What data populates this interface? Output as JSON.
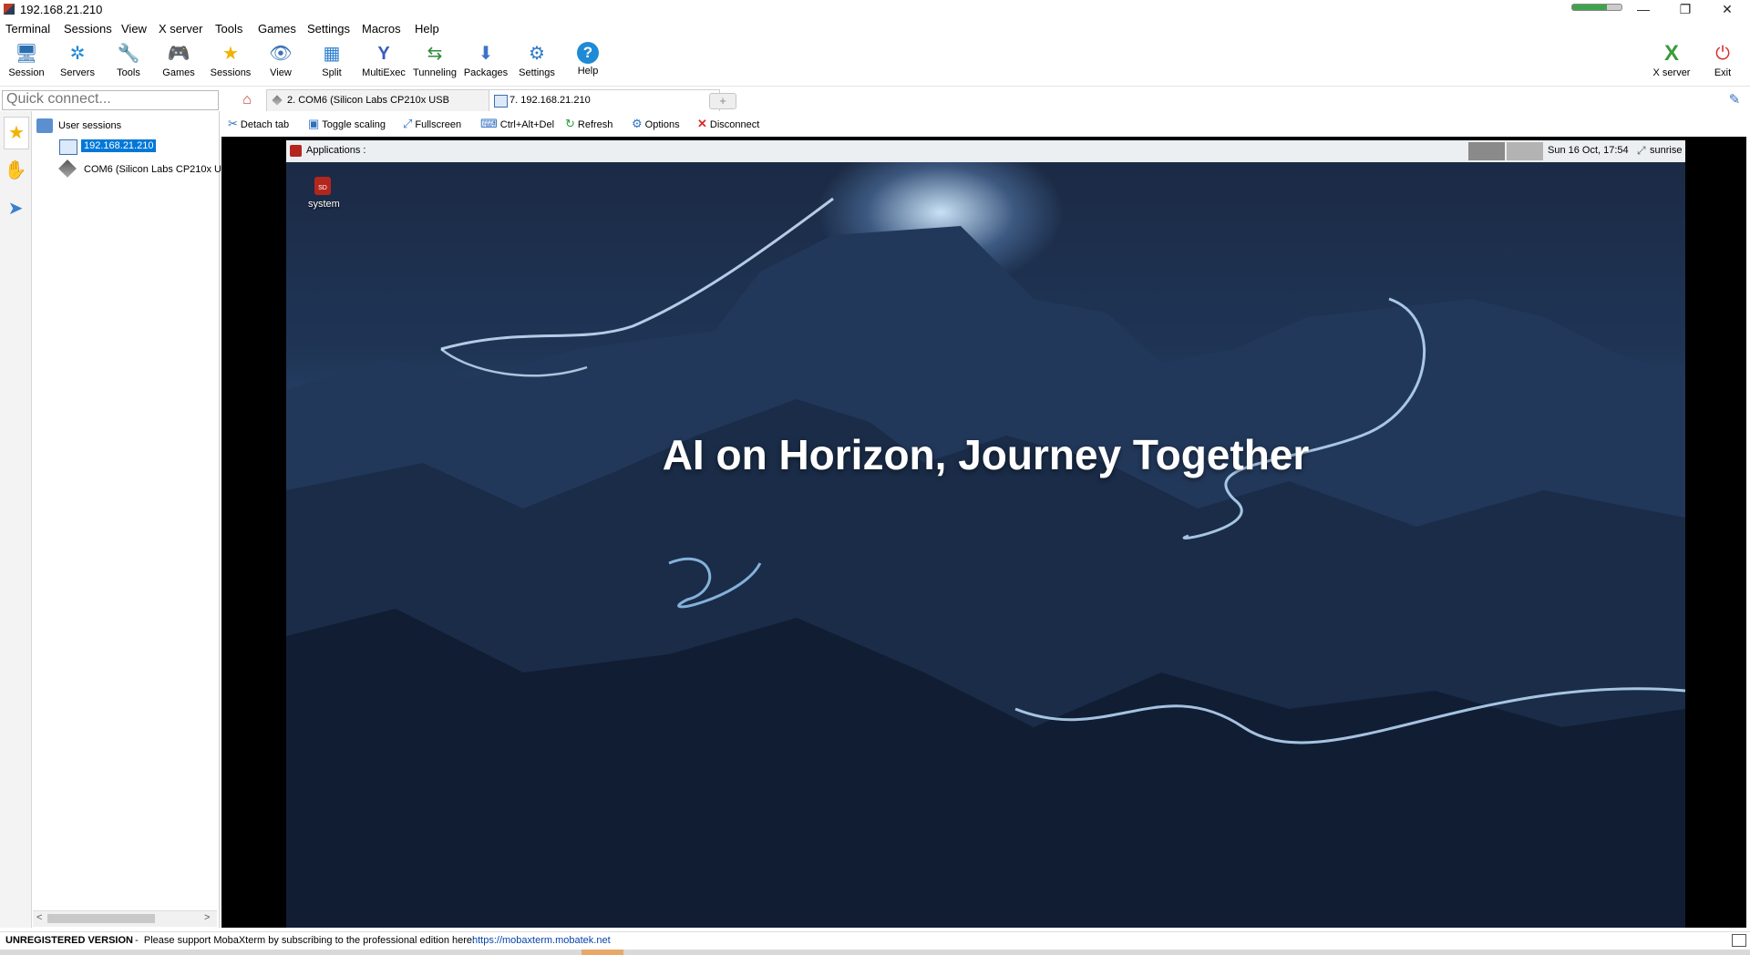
{
  "window": {
    "title": "192.168.21.210",
    "controls": [
      "—",
      "❐",
      "✕"
    ]
  },
  "menu": [
    "Terminal",
    "Sessions",
    "View",
    "X server",
    "Tools",
    "Games",
    "Settings",
    "Macros",
    "Help"
  ],
  "toolbar": {
    "items": [
      {
        "label": "Session",
        "icon": "session-icon",
        "glyph": "🖥",
        "color": "#2a6fb0"
      },
      {
        "label": "Servers",
        "icon": "servers-icon",
        "glyph": "✲",
        "color": "#1f8ad6"
      },
      {
        "label": "Tools",
        "icon": "tools-icon",
        "glyph": "🔧",
        "color": "#d8413a"
      },
      {
        "label": "Games",
        "icon": "games-icon",
        "glyph": "🎮",
        "color": "#666"
      },
      {
        "label": "Sessions",
        "icon": "star-icon",
        "glyph": "★",
        "color": "#f2b200"
      },
      {
        "label": "View",
        "icon": "view-icon",
        "glyph": "👁",
        "color": "#3a73b5"
      },
      {
        "label": "Split",
        "icon": "split-icon",
        "glyph": "▦",
        "color": "#2c7fd0"
      },
      {
        "label": "MultiExec",
        "icon": "multiexec-icon",
        "glyph": "Y",
        "color": "#3a5cc0"
      },
      {
        "label": "Tunneling",
        "icon": "tunneling-icon",
        "glyph": "⇆",
        "color": "#2f8a3a"
      },
      {
        "label": "Packages",
        "icon": "packages-icon",
        "glyph": "⬇",
        "color": "#3d73c9"
      },
      {
        "label": "Settings",
        "icon": "settings-icon",
        "glyph": "⚙",
        "color": "#2f7ac5"
      },
      {
        "label": "Help",
        "icon": "help-icon",
        "glyph": "?",
        "color": "#1f8ad6"
      }
    ],
    "right_items": [
      {
        "label": "X server",
        "icon": "xserver-icon",
        "glyph": "X",
        "color": "#3c9b3c"
      },
      {
        "label": "Exit",
        "icon": "exit-icon",
        "glyph": "⏻",
        "color": "#d92c2c"
      }
    ]
  },
  "quick_connect": {
    "placeholder": "Quick connect..."
  },
  "tabs": [
    {
      "label": "2. COM6  (Silicon Labs CP210x USB",
      "active": false
    },
    {
      "label": "7. 192.168.21.210",
      "active": true
    }
  ],
  "sessions": {
    "root": "User sessions",
    "items": [
      "192.168.21.210",
      "COM6  (Silicon Labs CP210x U:"
    ]
  },
  "session_toolbar": [
    "Detach tab",
    "Toggle scaling",
    "Fullscreen",
    "Ctrl+Alt+Del",
    "Refresh",
    "Options",
    "Disconnect"
  ],
  "remote": {
    "panel_menu": "Applications :",
    "clock": "Sun 16 Oct, 17:54",
    "user": "sunrise",
    "desktop_icon": "system",
    "motto": "AI on Horizon, Journey Together"
  },
  "status": {
    "prefix": "UNREGISTERED VERSION",
    "message": "  -  Please support MobaXterm by subscribing to the professional edition here:  ",
    "link": "https://mobaxterm.mobatek.net"
  },
  "colors": {
    "selection": "#0078d7",
    "link": "#0645ad",
    "accent_red": "#d92c2c"
  }
}
